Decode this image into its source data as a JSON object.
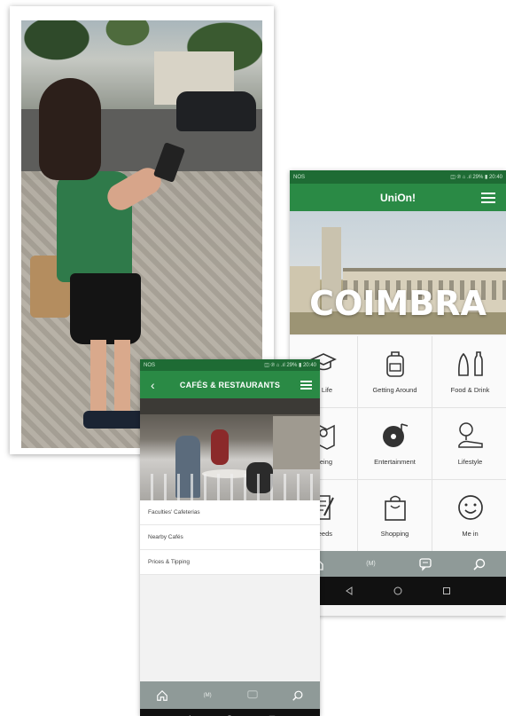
{
  "home_screen": {
    "status_left": "NOS",
    "status_right": "◫ ℗ ⌂ .ıl 29% ▮ 20:40",
    "app_title": "UniOn!",
    "hero_city": "COIMBRA",
    "tiles": [
      {
        "label": "Life",
        "icon": "graduation-cap-icon"
      },
      {
        "label": "Getting Around",
        "icon": "backpack-icon"
      },
      {
        "label": "Food & Drink",
        "icon": "bread-bottle-icon"
      },
      {
        "label": "Seeing",
        "icon": "map-pin-icon"
      },
      {
        "label": "Entertainment",
        "icon": "record-music-icon"
      },
      {
        "label": "Lifestyle",
        "icon": "tree-sneaker-icon"
      },
      {
        "label": "es & Needs",
        "icon": "notepad-pen-icon"
      },
      {
        "label": "Shopping",
        "icon": "shopping-bag-icon"
      },
      {
        "label": "Me in",
        "icon": "smiley-icon"
      }
    ],
    "bottom_nav": [
      "home-icon",
      "map-icon",
      "chat-icon",
      "search-icon"
    ],
    "bottom_nav_map_label": "(M)",
    "system_nav": [
      "back-triangle-icon",
      "home-circle-icon",
      "recents-square-icon"
    ]
  },
  "cafes_screen": {
    "status_left": "NOS",
    "status_right": "◫ ℗ ⌂ .ıl 29% ▮ 20:40",
    "back_glyph": "‹",
    "title": "CAFÉS & RESTAURANTS",
    "list_items": [
      "Faculties' Cafeterias",
      "Nearby Cafés",
      "Prices & Tipping"
    ],
    "bottom_nav": [
      "home-icon",
      "map-icon",
      "chat-icon",
      "search-icon"
    ],
    "bottom_nav_map_label": "(M)"
  },
  "colors": {
    "brand_green": "#2a8a45",
    "status_green": "#1e6b34",
    "nav_gray": "#8f9a98"
  }
}
